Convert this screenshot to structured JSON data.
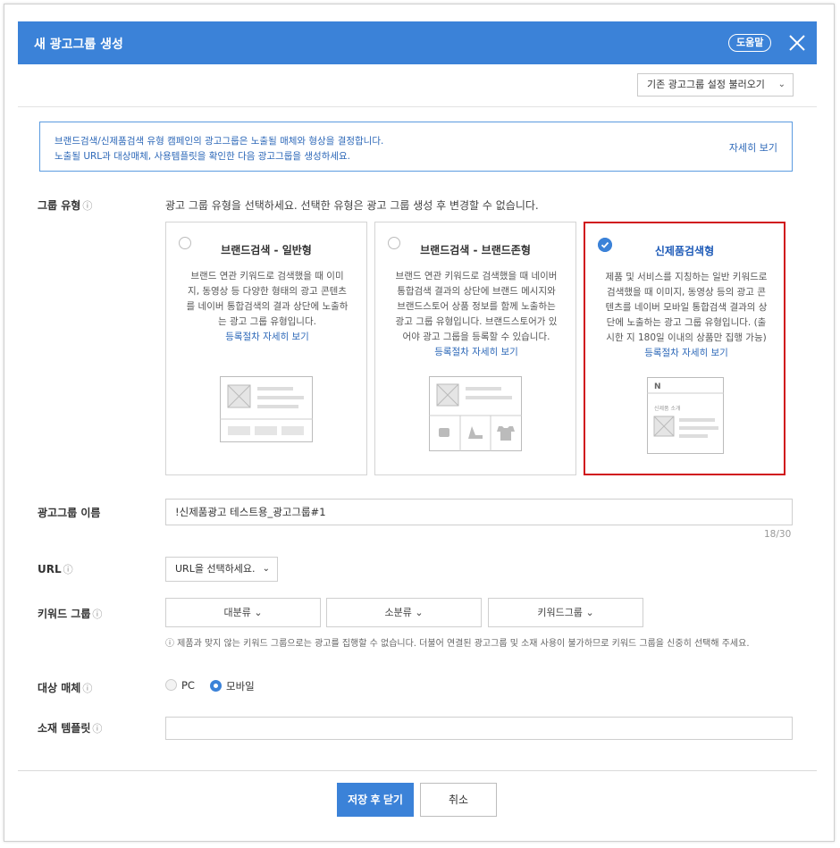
{
  "dialog": {
    "title": "새 광고그룹 생성",
    "help_label": "도움말",
    "load_settings_label": "기존 광고그룹 설정 불러오기",
    "accent_color": "#3b82d8"
  },
  "notice": {
    "line1": "브랜드검색/신제품검색 유형 캠페인의 광고그룹은 노출될 매체와 형상을 결정합니다.",
    "line2": "노출될 URL과 대상매체, 사용템플릿을 확인한 다음 광고그룹을 생성하세요.",
    "more_label": "자세히 보기"
  },
  "group_type": {
    "label": "그룹 유형",
    "help_icon": "ⓘ",
    "description": "광고 그룹 유형을 선택하세요. 선택한 유형은 광고 그룹 생성 후 변경할 수 없습니다.",
    "cards": [
      {
        "title": "브랜드검색 - 일반형",
        "lines": [
          "브랜드 연관 키워드로 검색했을 때 이미",
          "지, 동영상 등 다양한 형태의 광고 콘텐츠",
          "를 네이버 통합검색의 결과 상단에 노출하",
          "는 광고 그룹 유형입니다."
        ],
        "link": "등록절차 자세히 보기",
        "selected": false
      },
      {
        "title": "브랜드검색 - 브랜드존형",
        "lines": [
          "브랜드 연관 키워드로 검색했을 때 네이버",
          "통합검색 결과의 상단에 브랜드 메시지와",
          "브랜드스토어 상품 정보를 함께 노출하는",
          "광고 그룹 유형입니다. 브랜드스토어가 있",
          "어야 광고 그룹을 등록할 수 있습니다."
        ],
        "link": "등록절차 자세히 보기",
        "selected": false
      },
      {
        "title": "신제품검색형",
        "lines": [
          "제품 및 서비스를 지칭하는 일반 키워드로",
          "검색했을 때 이미지, 동영상 등의 광고 콘",
          "텐츠를 네이버 모바일 통합검색 결과의 상",
          "단에 노출하는 광고 그룹 유형입니다. (출",
          "시한 지 180일 이내의 상품만 집행 가능)"
        ],
        "link": "등록절차 자세히 보기",
        "selected": true,
        "preview_logo": "N",
        "preview_caption": "신제품 소개"
      }
    ]
  },
  "ad_group_name": {
    "label": "광고그룹 이름",
    "value": "!신제품광고 테스트용_광고그룹#1",
    "counter": "18/30"
  },
  "url": {
    "label": "URL",
    "placeholder": "URL을 선택하세요."
  },
  "keyword_group": {
    "label": "키워드 그룹",
    "buttons": [
      "대분류",
      "소분류",
      "키워드그룹"
    ],
    "note": "ⓘ 제품과 맞지 않는 키워드 그룹으로는 광고를 집행할 수 없습니다. 더불어 연결된 광고그룹 및 소재 사용이 불가하므로 키워드 그룹을 신중히 선택해 주세요."
  },
  "target_media": {
    "label": "대상 매체",
    "options": [
      "PC",
      "모바일"
    ],
    "selected": "모바일"
  },
  "template": {
    "label": "소재 템플릿",
    "value": ""
  },
  "footer": {
    "save_label": "저장 후 닫기",
    "cancel_label": "취소"
  }
}
